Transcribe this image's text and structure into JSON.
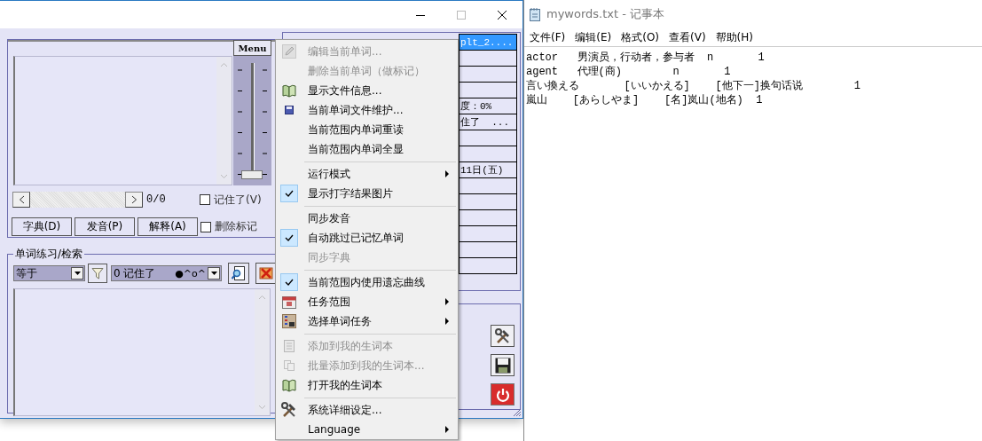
{
  "word_panel": {
    "menu_button": "Menu",
    "slider": {
      "level": 0
    },
    "counter": "0/0",
    "remembered_checkbox": {
      "label": "记住了(V)",
      "checked": false
    },
    "buttons": [
      "字典(D)",
      "发音(P)",
      "解释(A)"
    ],
    "delete_mark_checkbox": {
      "label": "删除标记",
      "checked": false
    }
  },
  "practice_group": {
    "title": "单词练习/检索",
    "match_combo": {
      "value": "等于"
    },
    "status_combo": {
      "value": "0 记住了",
      "emoticon": "●^o^"
    }
  },
  "info_group": {
    "rows": [
      {
        "text": "plt_2....",
        "selected": true
      },
      {
        "selected": false
      },
      {
        "selected": false
      },
      {
        "selected": false
      },
      {
        "text": "度：0%",
        "selected": false
      },
      {
        "text": "住了  ...",
        "selected": false
      },
      {
        "selected": false
      },
      {
        "selected": false
      },
      {
        "text": "11日(五)",
        "selected": false
      },
      {
        "selected": false
      },
      {
        "selected": false
      },
      {
        "selected": false
      },
      {
        "selected": false
      },
      {
        "selected": false
      },
      {
        "selected": false
      }
    ]
  },
  "context_menu": {
    "items": [
      {
        "kind": "item",
        "label": "编辑当前单词...",
        "disabled": true,
        "checked": false,
        "submenu": false
      },
      {
        "kind": "item",
        "label": "删除当前单词（做标记）",
        "disabled": true,
        "checked": false,
        "submenu": false
      },
      {
        "kind": "item",
        "label": "显示文件信息...",
        "disabled": false,
        "checked": false,
        "submenu": false
      },
      {
        "kind": "item",
        "label": "当前单词文件维护...",
        "disabled": false,
        "checked": false,
        "submenu": false
      },
      {
        "kind": "item",
        "label": "当前范围内单词重读",
        "disabled": false,
        "checked": false,
        "submenu": false
      },
      {
        "kind": "item",
        "label": "当前范围内单词全显",
        "disabled": false,
        "checked": false,
        "submenu": false
      },
      {
        "kind": "separator"
      },
      {
        "kind": "item",
        "label": "运行模式",
        "disabled": false,
        "checked": false,
        "submenu": true
      },
      {
        "kind": "item",
        "label": "显示打字结果图片",
        "disabled": false,
        "checked": true,
        "submenu": false
      },
      {
        "kind": "separator"
      },
      {
        "kind": "item",
        "label": "同步发音",
        "disabled": false,
        "checked": false,
        "submenu": false
      },
      {
        "kind": "item",
        "label": "自动跳过已记忆单词",
        "disabled": false,
        "checked": true,
        "submenu": false
      },
      {
        "kind": "item",
        "label": "同步字典",
        "disabled": true,
        "checked": false,
        "submenu": false
      },
      {
        "kind": "separator"
      },
      {
        "kind": "item",
        "label": "当前范围内使用遗忘曲线",
        "disabled": false,
        "checked": true,
        "submenu": false
      },
      {
        "kind": "item",
        "label": "任务范围",
        "disabled": false,
        "checked": false,
        "submenu": true
      },
      {
        "kind": "item",
        "label": "选择单词任务",
        "disabled": false,
        "checked": false,
        "submenu": true
      },
      {
        "kind": "separator"
      },
      {
        "kind": "item",
        "label": "添加到我的生词本",
        "disabled": true,
        "checked": false,
        "submenu": false
      },
      {
        "kind": "item",
        "label": "批量添加到我的生词本...",
        "disabled": true,
        "checked": false,
        "submenu": false
      },
      {
        "kind": "item",
        "label": "打开我的生词本",
        "disabled": false,
        "checked": false,
        "submenu": false
      },
      {
        "kind": "separator"
      },
      {
        "kind": "item",
        "label": "系统详细设定...",
        "disabled": false,
        "checked": false,
        "submenu": false
      },
      {
        "kind": "item",
        "label": "Language",
        "disabled": false,
        "checked": false,
        "submenu": true
      }
    ]
  },
  "notepad": {
    "title": "mywords.txt - 记事本",
    "menu": [
      "文件(F)",
      "编辑(E)",
      "格式(O)",
      "查看(V)",
      "帮助(H)"
    ],
    "lines": [
      "actor   男演员，行动者，参与者  n       1",
      "agent   代理(商)        n       1",
      "言い換える       [いいかえる]    [他下一]换句话说        1",
      "嵐山    [あらしやま]    [名]岚山(地名)  1"
    ]
  }
}
